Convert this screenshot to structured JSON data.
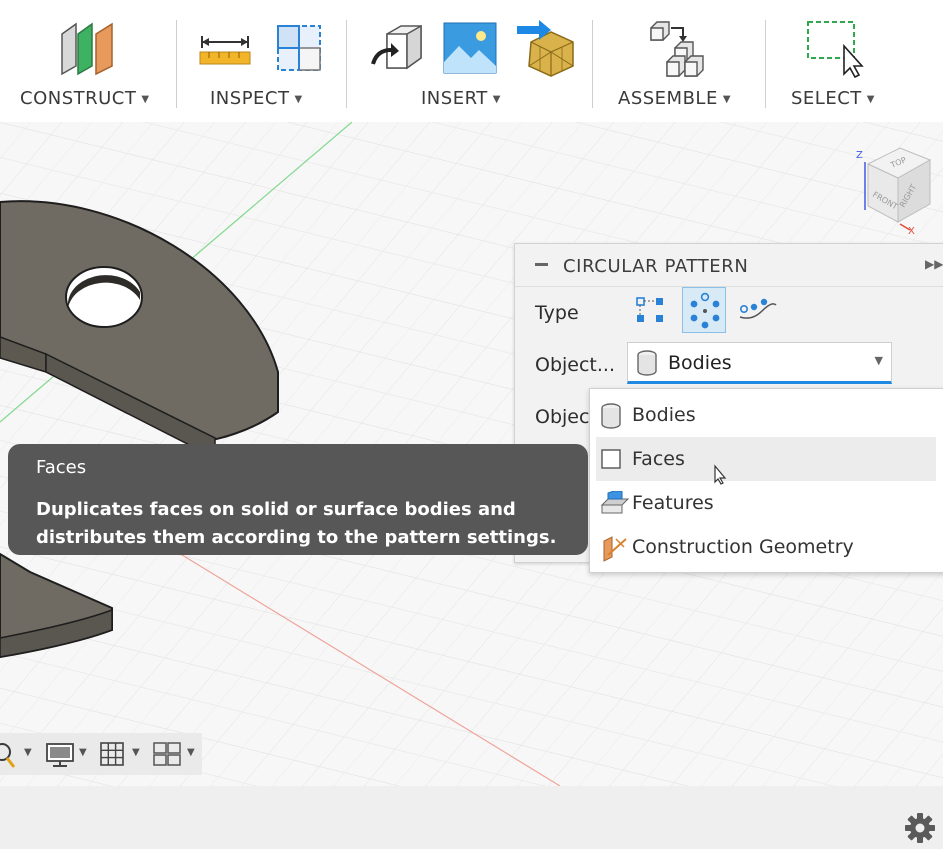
{
  "toolbar": {
    "groups": [
      {
        "label": "CONSTRUCT",
        "icon": "construct-planes-icon"
      },
      {
        "label": "INSPECT",
        "icon": "measure-ruler-icon"
      },
      {
        "label": "INSERT",
        "icon": "insert-image-icon"
      },
      {
        "label": "ASSEMBLE",
        "icon": "assemble-components-icon"
      },
      {
        "label": "SELECT",
        "icon": "select-window-icon"
      }
    ]
  },
  "viewcube": {
    "face_top": "TOP",
    "face_front": "FRONT",
    "face_right": "RIGHT",
    "axis_z": "Z",
    "axis_x": "X"
  },
  "panel": {
    "title": "CIRCULAR PATTERN",
    "type_label": "Type",
    "objects_label": "Object...",
    "objects_label2": "Objec",
    "pattern_type_selected": "circular",
    "object_type_value": "Bodies"
  },
  "dropdown": {
    "items": [
      {
        "label": "Bodies",
        "icon": "body-cylinder-icon"
      },
      {
        "label": "Faces",
        "icon": "face-square-icon"
      },
      {
        "label": "Features",
        "icon": "feature-extrude-icon"
      },
      {
        "label": "Construction Geometry",
        "icon": "construction-geometry-icon"
      }
    ],
    "hovered": "Faces"
  },
  "tooltip": {
    "title": "Faces",
    "description": "Duplicates faces on solid or surface bodies and distributes them according to the pattern settings."
  },
  "colors": {
    "accent": "#1f8ae0",
    "tooltip_bg": "#575757",
    "body_fill": "#6f6a62"
  }
}
